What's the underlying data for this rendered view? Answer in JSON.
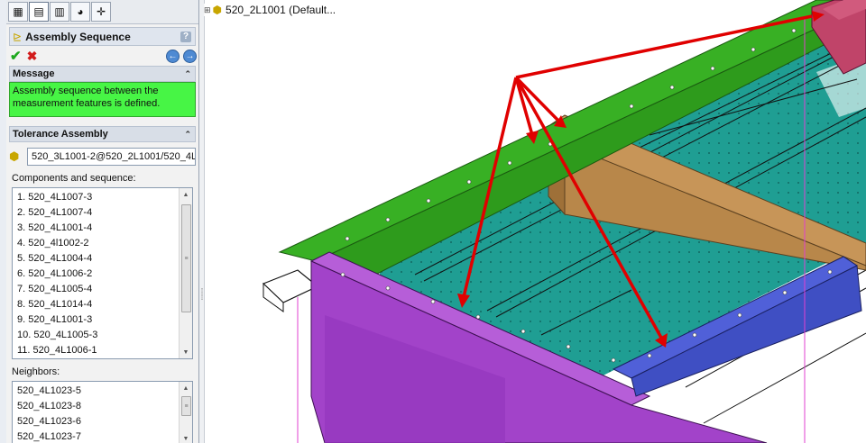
{
  "tabs": [
    {
      "icon": "feature-manager-icon",
      "glyph": "▦"
    },
    {
      "icon": "property-manager-icon",
      "glyph": "▤"
    },
    {
      "icon": "configuration-manager-icon",
      "glyph": "▥"
    },
    {
      "icon": "display-manager-icon",
      "glyph": "◕"
    },
    {
      "icon": "dimxpert-icon",
      "glyph": "✛"
    }
  ],
  "pm": {
    "title": "Assembly Sequence",
    "help": "?"
  },
  "message": {
    "header": "Message",
    "text_line1": "Assembly sequence between the",
    "text_line2": "measurement features is defined."
  },
  "tolerance": {
    "header": "Tolerance Assembly",
    "field_value": "520_3L1001-2@520_2L1001/520_4L",
    "components_label": "Components and sequence:",
    "components": [
      "1. 520_4L1007-3",
      "2. 520_4L1007-4",
      "3. 520_4L1001-4",
      "4. 520_4l1002-2",
      "5. 520_4L1004-4",
      "6. 520_4L1006-2",
      "7. 520_4L1005-4",
      "8. 520_4L1014-4",
      "9. 520_4L1001-3",
      "10. 520_4L1005-3",
      "11. 520_4L1006-1"
    ],
    "neighbors_label": "Neighbors:",
    "neighbors": [
      "520_4L1023-5",
      "520_4L1023-8",
      "520_4L1023-6",
      "520_4L1023-7"
    ]
  },
  "tree": {
    "expander": "⊞",
    "root_label": "520_2L1001  (Default..."
  },
  "colors": {
    "green_rail": "#2e9b1c",
    "purple_rail": "#a243c9",
    "blue_rail": "#3f4fc3",
    "orange_beam": "#b8874a",
    "teal_panel": "#1f9e93",
    "maroon_part": "#b23a5e",
    "arrow_red": "#e00000",
    "message_bg": "#47f545"
  }
}
